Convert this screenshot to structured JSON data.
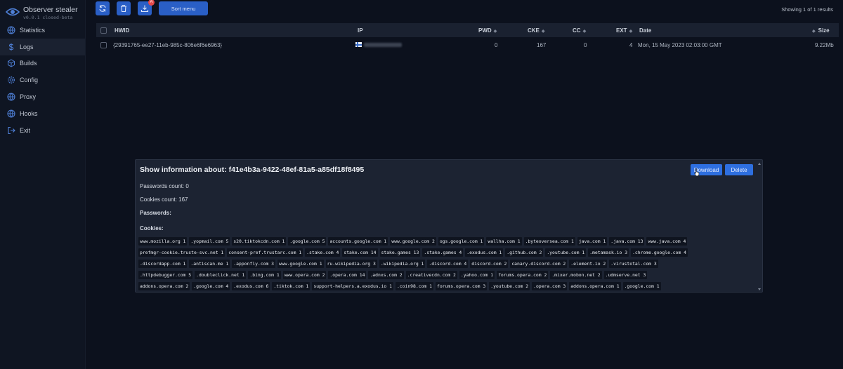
{
  "app": {
    "name": "Observer stealer",
    "version": "v0.0.1 closed-beta"
  },
  "sidebar": {
    "items": [
      {
        "label": "Statistics",
        "icon": "globe-icon"
      },
      {
        "label": "Logs",
        "icon": "dollar-icon"
      },
      {
        "label": "Builds",
        "icon": "box-icon"
      },
      {
        "label": "Config",
        "icon": "gear-icon"
      },
      {
        "label": "Proxy",
        "icon": "globe-icon"
      },
      {
        "label": "Hooks",
        "icon": "globe-icon"
      },
      {
        "label": "Exit",
        "icon": "exit-icon"
      }
    ],
    "active": "Logs"
  },
  "toolbar": {
    "sort_label": "Sort menu",
    "badge": "A"
  },
  "showing": "Showing 1 of 1 results",
  "table": {
    "headers": {
      "hwid": "HWID",
      "ip": "IP",
      "pwd": "PWD",
      "cke": "CKE",
      "cc": "CC",
      "ext": "EXT",
      "date": "Date",
      "size": "Size"
    },
    "rows": [
      {
        "hwid": "{29391765-ee27-11eb-985c-806e6f6e6963}",
        "pwd": "0",
        "cke": "167",
        "cc": "0",
        "ext": "4",
        "date": "Mon, 15 May 2023 02:03:00 GMT",
        "size": "9.22Mb"
      }
    ]
  },
  "modal": {
    "title": "Show information about: f41e4b3a-9422-48ef-81a5-a85df18f8495",
    "download_label": "Download",
    "delete_label": "Delete",
    "passwords_count": "Passwords count: 0",
    "cookies_count": "Cookies count: 167",
    "passwords_heading": "Passwords:",
    "cookies_heading": "Cookies:",
    "cookies": [
      [
        "www.mozilla.org 1",
        ".yopmail.com 5",
        "s20.tiktokcdn.com 1",
        ".google.com 5",
        "accounts.google.com 1",
        "www.google.com 2",
        "ogs.google.com 1",
        "wallha.com 1",
        ".byteoversea.com 1",
        "java.com 1",
        ".java.com 13",
        "www.java.com 4"
      ],
      [
        "prefmgr-cookie.truste-svc.net 1",
        "consent-pref.trustarc.com 1",
        ".stake.com 4",
        "stake.com 14",
        "stake.games 13",
        ".stake.games 4",
        ".exodus.com 1",
        ".github.com 2",
        ".youtube.com 1",
        ".metamask.io 3",
        ".chrome.google.com 4"
      ],
      [
        ".discordapp.com 1",
        ".antiscan.me 1",
        ".apponfly.com 3",
        "www.google.com 1",
        "ru.wikipedia.org 3",
        ".wikipedia.org 1",
        ".discord.com 4",
        "discord.com 2",
        "canary.discord.com 2",
        ".element.io 2",
        ".virustotal.com 3"
      ],
      [
        ".httpdebugger.com 5",
        ".doubleclick.net 1",
        ".bing.com 1",
        "www.opera.com 2",
        ".opera.com 14",
        ".adnxs.com 2",
        ".creativecdn.com 2",
        ".yahoo.com 1",
        "forums.opera.com 2",
        ".mixer.mobon.net 2",
        ".udmserve.net 3"
      ],
      [
        "addons.opera.com 2",
        ".google.com 4",
        ".exodus.com 6",
        ".tiktok.com 1",
        "support-helpers.a.exodus.io 1",
        ".coin98.com 1",
        "forums.opera.com 3",
        ".youtube.com 2",
        ".opera.com 3",
        "addons.opera.com 1",
        ".google.com 1"
      ]
    ]
  },
  "colors": {
    "accent": "#2a5fc6",
    "background": "#0c111d",
    "modal": "#1c2332"
  }
}
